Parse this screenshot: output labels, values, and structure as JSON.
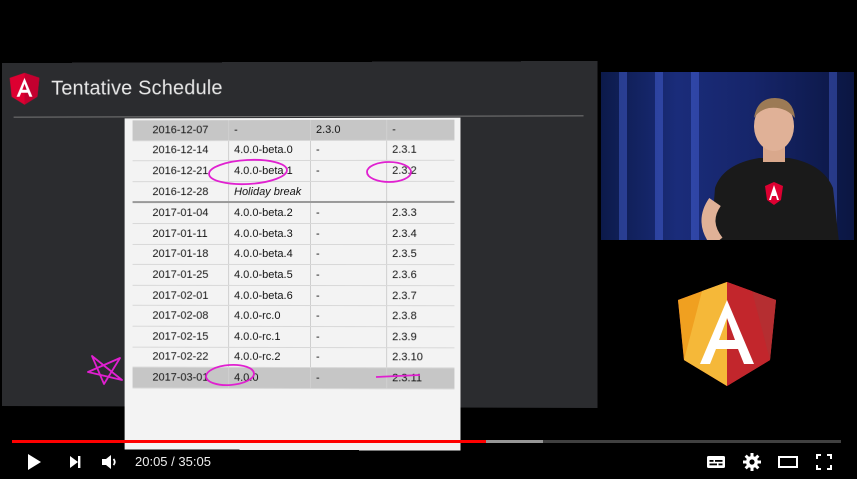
{
  "slide": {
    "title": "Tentative Schedule",
    "rows": [
      {
        "date": "2016-12-07",
        "ng4": "-",
        "mid": "2.3.0",
        "ng2": "-",
        "shaded": true
      },
      {
        "date": "2016-12-14",
        "ng4": "4.0.0-beta.0",
        "mid": "-",
        "ng2": "2.3.1"
      },
      {
        "date": "2016-12-21",
        "ng4": "4.0.0-beta.1",
        "mid": "-",
        "ng2": "2.3.2"
      },
      {
        "date": "2016-12-28",
        "ng4": "Holiday break",
        "mid": "",
        "ng2": "",
        "italic": true,
        "divider": true
      },
      {
        "date": "2017-01-04",
        "ng4": "4.0.0-beta.2",
        "mid": "-",
        "ng2": "2.3.3"
      },
      {
        "date": "2017-01-11",
        "ng4": "4.0.0-beta.3",
        "mid": "-",
        "ng2": "2.3.4"
      },
      {
        "date": "2017-01-18",
        "ng4": "4.0.0-beta.4",
        "mid": "-",
        "ng2": "2.3.5"
      },
      {
        "date": "2017-01-25",
        "ng4": "4.0.0-beta.5",
        "mid": "-",
        "ng2": "2.3.6"
      },
      {
        "date": "2017-02-01",
        "ng4": "4.0.0-beta.6",
        "mid": "-",
        "ng2": "2.3.7"
      },
      {
        "date": "2017-02-08",
        "ng4": "4.0.0-rc.0",
        "mid": "-",
        "ng2": "2.3.8"
      },
      {
        "date": "2017-02-15",
        "ng4": "4.0.0-rc.1",
        "mid": "-",
        "ng2": "2.3.9"
      },
      {
        "date": "2017-02-22",
        "ng4": "4.0.0-rc.2",
        "mid": "-",
        "ng2": "2.3.10"
      },
      {
        "date": "2017-03-01",
        "ng4": "4.0.0",
        "mid": "-",
        "ng2": "2.3.11",
        "shaded": true
      }
    ]
  },
  "player": {
    "current_time": "20:05",
    "separator": " / ",
    "duration": "35:05",
    "played_fraction": 0.572,
    "buffered_fraction": 0.641
  },
  "colors": {
    "accent_red": "#ff0000",
    "annotation_magenta": "#e020d0",
    "angular_red": "#dd0031",
    "slide_bg": "#2b2c2f"
  },
  "icons": {
    "play": "play-icon",
    "next": "next-icon",
    "volume": "volume-icon",
    "subtitles": "subtitles-icon",
    "settings": "gear-icon",
    "theater": "theater-mode-icon",
    "fullscreen": "fullscreen-icon"
  }
}
